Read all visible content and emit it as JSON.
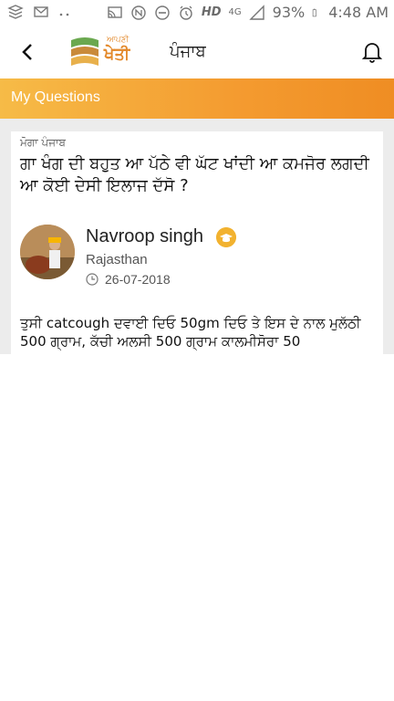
{
  "status_bar": {
    "battery": "93%",
    "time": "4:48 AM",
    "network": "HD",
    "signal": "4G",
    "icons": [
      "layers-icon",
      "envelope-icon",
      "dots-icon",
      "cast-icon",
      "nfc-icon",
      "minus-circle-icon",
      "alarm-icon",
      "hd-icon",
      "4g-icon",
      "signal-icon",
      "battery-icon"
    ]
  },
  "header": {
    "logo_small": "ਆਪਣੀ",
    "logo_big": "ਖੇਤੀ",
    "region": "ਪੰਜਾਬ",
    "icons": [
      "back-arrow-icon",
      "bell-icon"
    ]
  },
  "section": {
    "title": "My Questions",
    "color_start": "#f6bb47",
    "color_end": "#ef8d23"
  },
  "question_card": {
    "location": "ਮੋਗਾ ਪੰਜਾਬ",
    "question": "ਗਾ ਖੰਗ ਦੀ ਬਹੁਤ ਆ ਪੱਠੇ ਵੀ ਘੱਟ ਖਾਂਦੀ ਆ ਕਮਜੋਰ ਲਗਦੀ ਆ ਕੋਈ ਦੇਸੀ ਇਲਾਜ ਦੱਸੋ ?",
    "expert": {
      "name": "Navroop singh",
      "state": "Rajasthan",
      "date": "26-07-2018"
    },
    "answer": "ਤੁਸੀ catcough ਦਵਾਈ ਦਿਓ 50gm ਦਿਓ ਤੇ ਇਸ ਦੇ ਨਾਲ ਮੁਲੱਠੀ 500 ਗ੍ਰਾਮ, ਕੱਚੀ ਅਲਸੀ 500 ਗ੍ਰਾਮ ਕਾਲਮੀਸੋਰਾ 50"
  }
}
